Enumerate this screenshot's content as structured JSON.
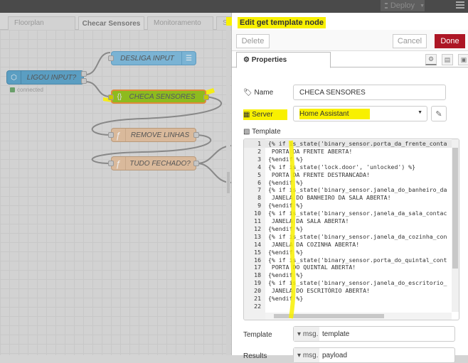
{
  "topbar": {
    "deploy_label": "Deploy"
  },
  "workspace_tabs": [
    {
      "label": "Floorplan",
      "active": false
    },
    {
      "label": "Checar Sensores",
      "active": true
    },
    {
      "label": "Monitoramento",
      "active": false
    },
    {
      "label": "S",
      "active": false
    }
  ],
  "flow": {
    "nodes": [
      {
        "id": "ligou",
        "label": "LIGOU INPUT?",
        "type": "ha-state",
        "color": "#5b9ec2",
        "status": "connected"
      },
      {
        "id": "desliga",
        "label": "DESLIGA INPUT",
        "type": "ha-service",
        "color": "#7ab3d4"
      },
      {
        "id": "checa",
        "label": "CHECA SENSORES",
        "type": "template",
        "color": "#7ab3d4",
        "selected": true
      },
      {
        "id": "remove",
        "label": "REMOVE LINHAS",
        "type": "function",
        "color": "#d9b99b"
      },
      {
        "id": "tudo",
        "label": "TUDO FECHADO?",
        "type": "function",
        "color": "#d9b99b"
      }
    ],
    "highlight_color": "#f8f000"
  },
  "panel": {
    "title": "Edit get template node",
    "delete_label": "Delete",
    "cancel_label": "Cancel",
    "done_label": "Done",
    "done_color": "#ad1625",
    "tab_label": "Properties",
    "name_label": "Name",
    "name_value": "CHECA SENSORES",
    "server_label": "Server",
    "server_value": "Home Assistant",
    "template_label": "Template",
    "template_lines": [
      "{% if is_state('binary_sensor.porta_da_frente_conta",
      " PORTA DA FRENTE ABERTA!",
      "{%endif %}",
      "{% if is_state('lock.door', 'unlocked') %}",
      " PORTA DA FRENTE DESTRANCADA!",
      "{%endif %}",
      "{% if is_state('binary_sensor.janela_do_banheiro_da",
      " JANELA DO BANHEIRO DA SALA ABERTA!",
      "{%endif %}",
      "{% if is_state('binary_sensor.janela_da_sala_contac",
      " JANELA DA SALA ABERTA!",
      "{%endif %}",
      "{% if is_state('binary_sensor.janela_da_cozinha_con",
      " JANELA DA COZINHA ABERTA!",
      "{%endif %}",
      "{% if is_state('binary_sensor.porta_do_quintal_cont",
      " PORTA DO QUINTAL ABERTA!",
      "{%endif %}",
      "{% if is_state('binary_sensor.janela_do_escritorio_",
      " JANELA DO ESCRITÓRIO ABERTA!",
      "{%endif %}",
      ""
    ],
    "template_field_label": "Template",
    "template_field_type": "msg.",
    "template_field_value": "template",
    "results_label": "Results",
    "results_type": "msg.",
    "results_value": "payload"
  }
}
